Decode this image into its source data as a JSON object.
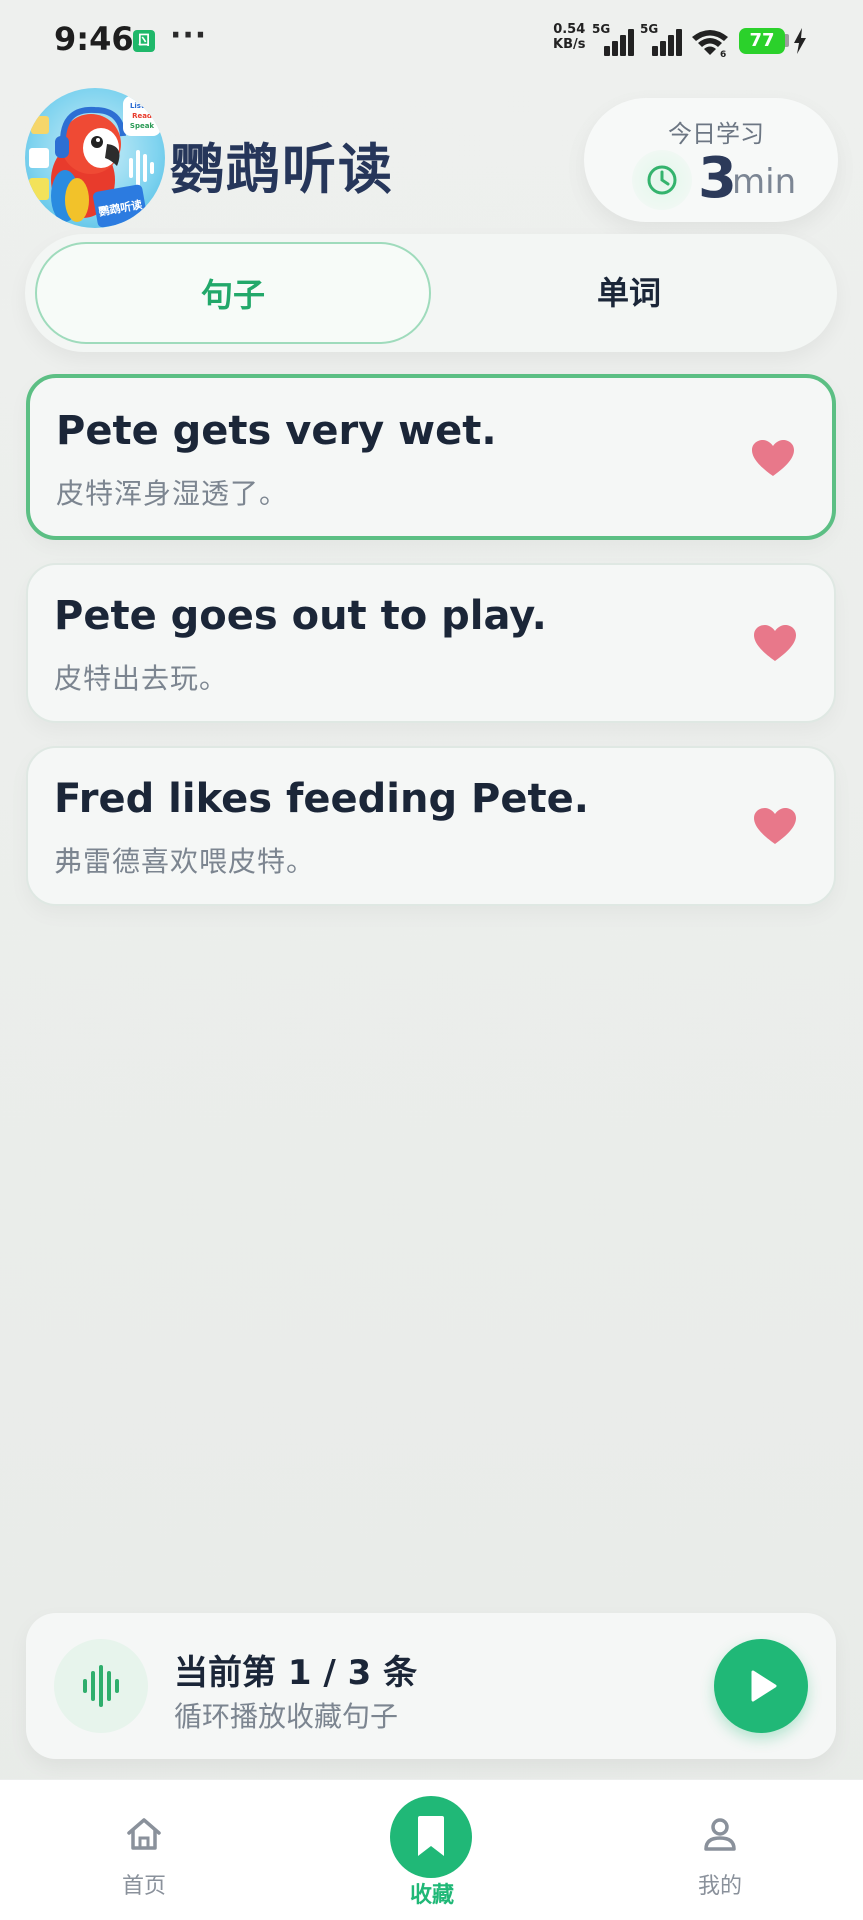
{
  "status_bar": {
    "time": "9:46",
    "app_badge": "ㄖ",
    "dots": "···",
    "net_speed_value": "0.54",
    "net_speed_unit": "KB/s",
    "signal1_label": "5G",
    "signal2_label": "5G",
    "wifi_sub": "6",
    "battery": "77"
  },
  "header": {
    "app_title": "鹦鹉听读",
    "today_label": "今日学习",
    "today_value": "3",
    "today_unit": "min",
    "logo_text_1": "Listen",
    "logo_text_2": "Read",
    "logo_text_3": "Speak",
    "logo_book": "鹦鹉听读"
  },
  "tabs": [
    {
      "label": "句子",
      "active": true
    },
    {
      "label": "单词",
      "active": false
    }
  ],
  "sentences": [
    {
      "en": "Pete gets very wet.",
      "zh": "皮特浑身湿透了。",
      "favorited": true
    },
    {
      "en": "Pete goes out to play.",
      "zh": "皮特出去玩。",
      "favorited": true
    },
    {
      "en": "Fred likes feeding Pete.",
      "zh": "弗雷德喜欢喂皮特。",
      "favorited": true
    }
  ],
  "player": {
    "line1": "当前第 1 / 3 条",
    "line2": "循环播放收藏句子"
  },
  "bottom_nav": [
    {
      "label": "首页",
      "icon": "home-icon"
    },
    {
      "label": "收藏",
      "icon": "bookmark-icon",
      "active": true
    },
    {
      "label": "我的",
      "icon": "user-icon"
    }
  ],
  "colors": {
    "accent": "#20b877",
    "heart": "#e8788a",
    "title": "#26365a"
  }
}
